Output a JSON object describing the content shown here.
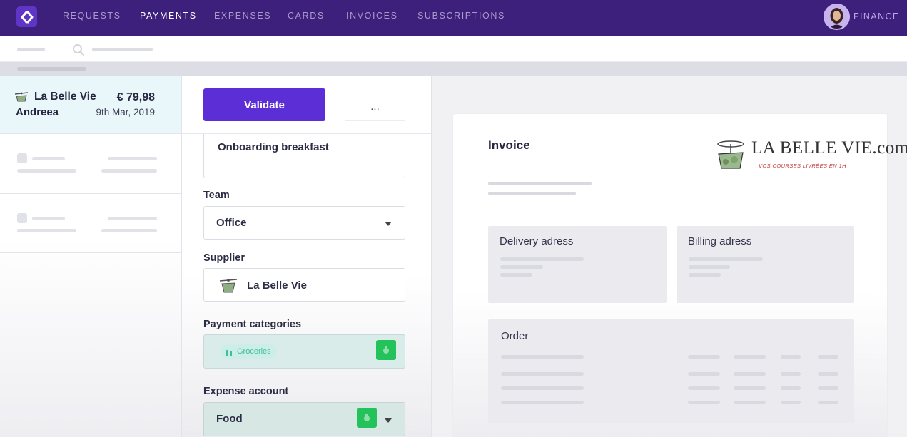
{
  "nav": {
    "items": [
      {
        "label": "REQUESTS",
        "active": false
      },
      {
        "label": "PAYMENTS",
        "active": true
      },
      {
        "label": "EXPENSES",
        "active": false
      },
      {
        "label": "CARDS",
        "active": false
      },
      {
        "label": "INVOICES",
        "active": false
      },
      {
        "label": "SUBSCRIPTIONS",
        "active": false
      }
    ],
    "role": "FINANCE"
  },
  "list": {
    "selected": {
      "supplier": "La Belle Vie",
      "amount": "€ 79,98",
      "user": "Andreea",
      "date": "9th Mar, 2019"
    }
  },
  "form": {
    "validate_label": "Validate",
    "more_label": "...",
    "description": "Onboarding breakfast",
    "team_label": "Team",
    "team_value": "Office",
    "supplier_label": "Supplier",
    "supplier_value": "La Belle Vie",
    "categories_label": "Payment categories",
    "category_tag": "Groceries",
    "expense_label": "Expense account",
    "expense_value": "Food"
  },
  "invoice": {
    "title": "Invoice",
    "logo_text": "LA BELLE VIE.com",
    "logo_tagline": "VOS COURSES LIVRÉES EN 1H",
    "delivery_title": "Delivery adress",
    "billing_title": "Billing adress",
    "order_title": "Order"
  },
  "colors": {
    "nav_bg": "#3d1f7c",
    "accent": "#5b2ed6",
    "category_green": "#23c25a",
    "selected_row": "#e9f7fb"
  }
}
